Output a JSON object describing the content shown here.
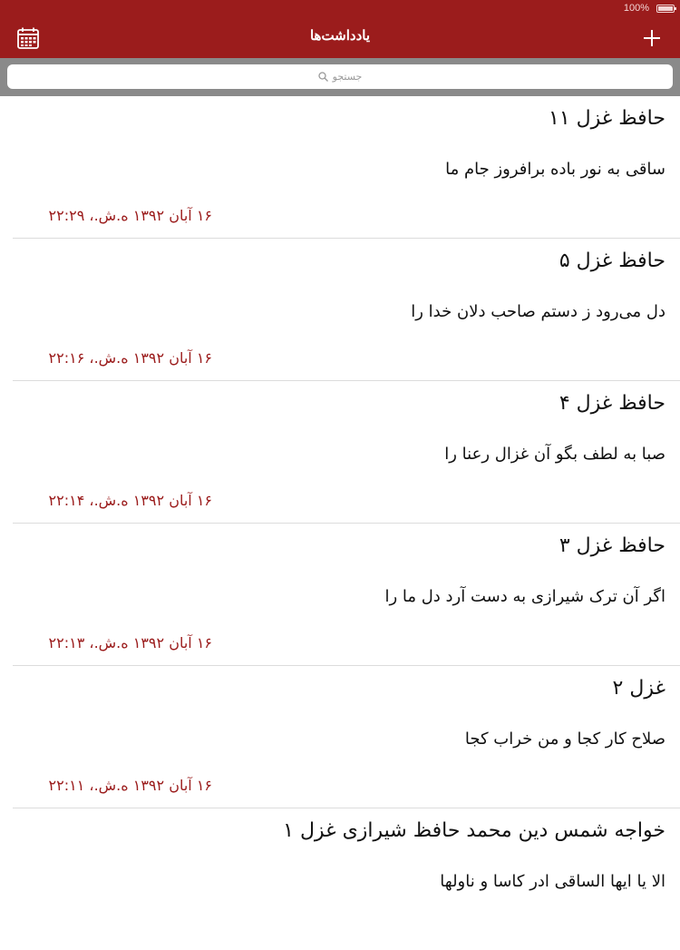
{
  "status_bar": {
    "battery_text": "100%"
  },
  "nav": {
    "title": "یادداشت‌ها",
    "left_icon": "calendar-icon",
    "right_icon": "plus-icon"
  },
  "search": {
    "placeholder": "جستجو",
    "icon": "search-icon"
  },
  "colors": {
    "accent": "#9b1c1c",
    "search_bar_bg": "#8a8a8a",
    "divider": "#dcdcdc"
  },
  "notes": [
    {
      "title": "حافظ غزل ۱۱",
      "preview": "ساقی به نور باده برافروز جام ما",
      "date": "۱۶ آبان ۱۳۹۲ ه.ش.، ۲۲:۲۹"
    },
    {
      "title": "حافظ غزل ۵",
      "preview": "دل می‌رود ز دستم صاحب دلان خدا را",
      "date": "۱۶ آبان ۱۳۹۲ ه.ش.، ۲۲:۱۶"
    },
    {
      "title": "حافظ غزل ۴",
      "preview": "صبا به لطف بگو آن غزال رعنا را",
      "date": "۱۶ آبان ۱۳۹۲ ه.ش.، ۲۲:۱۴"
    },
    {
      "title": "حافظ غزل ۳",
      "preview": "اگر آن ترک شیرازی به دست آرد دل ما را",
      "date": "۱۶ آبان ۱۳۹۲ ه.ش.، ۲۲:۱۳"
    },
    {
      "title": "غزل ۲",
      "preview": "صلاح کار کجا و من خراب کجا",
      "date": "۱۶ آبان ۱۳۹۲ ه.ش.، ۲۲:۱۱"
    },
    {
      "title": "خواجه شمس دین محمد حافظ شیرازی  غزل ۱",
      "preview": "الا یا ایها الساقی ادر کاسا و ناولها",
      "date": ""
    }
  ]
}
